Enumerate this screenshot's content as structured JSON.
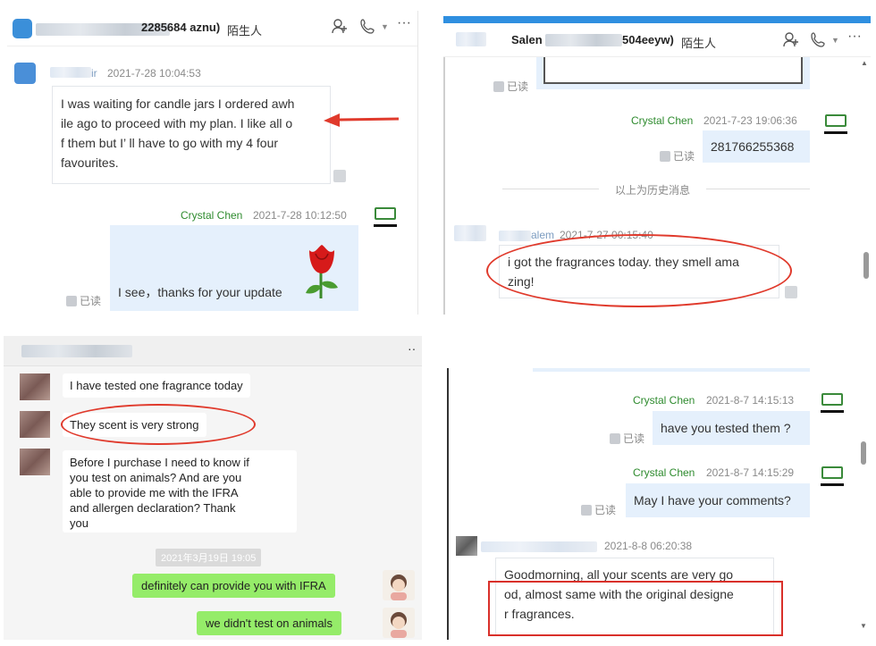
{
  "panel_tl": {
    "contact_tag": "陌生人",
    "id_partial": "2285684 aznu)",
    "sender_partial": "ir",
    "sender_time": "2021-7-28 10:04:53",
    "incoming_msg": "I was waiting for candle jars I ordered awh ile ago to proceed with my plan. I like all o f them but I’ ll have to go with my 4 four favourites.",
    "incoming_lines": [
      "I was waiting for candle jars I ordered awh",
      "ile ago to proceed with my plan. I like all o",
      "f them but I’ ll have to go with my 4 four",
      "favourites."
    ],
    "reply_name": "Crystal Chen",
    "reply_time": "2021-7-28 10:12:50",
    "reply_msg": "I see，thanks for your update",
    "read_label": "已读"
  },
  "panel_tr": {
    "title_partial": "Salen",
    "id_partial": "504eeyw)",
    "contact_tag": "陌生人",
    "read_label_1": "已读",
    "reply_name": "Crystal Chen",
    "reply_time": "2021-7-23 19:06:36",
    "reply_msg": "281766255368",
    "read_label_2": "已读",
    "history_divider": "以上为历史消息",
    "sender_partial": "alem",
    "sender_time": "2021-7-27 00:15:40",
    "incoming_lines": [
      "i got the fragrances today. they smell ama",
      "zing!"
    ]
  },
  "panel_bl": {
    "messages": [
      {
        "text": "I have tested one fragrance today"
      },
      {
        "text": "They scent is very strong"
      },
      {
        "lines": [
          "Before I purchase I need to know if",
          "you test on animals? And are you",
          "able to provide me with the IFRA",
          "and allergen declaration? Thank",
          "you"
        ]
      }
    ],
    "date_divider": "2021年3月19日 19:05",
    "replies": [
      "definitely can provide you with IFRA",
      "we didn't test on animals"
    ],
    "menu_dots": "··"
  },
  "panel_br": {
    "reply1_name": "Crystal Chen",
    "reply1_time": "2021-8-7 14:15:13",
    "reply1_msg": "have you tested them ?",
    "reply2_name": "Crystal Chen",
    "reply2_time": "2021-8-7 14:15:29",
    "reply2_msg": "May I have your comments?",
    "read_label": "已读",
    "sender_time": "2021-8-8 06:20:38",
    "incoming_lines": [
      "Goodmorning, all your scents are very go",
      "od, almost same with the original designe",
      "r fragrances."
    ]
  },
  "colors": {
    "annotation_red": "#e03a2c",
    "blue_bubble": "#e5f0fc",
    "wechat_green": "#95ec69",
    "sender_green": "#2e8b2e"
  }
}
